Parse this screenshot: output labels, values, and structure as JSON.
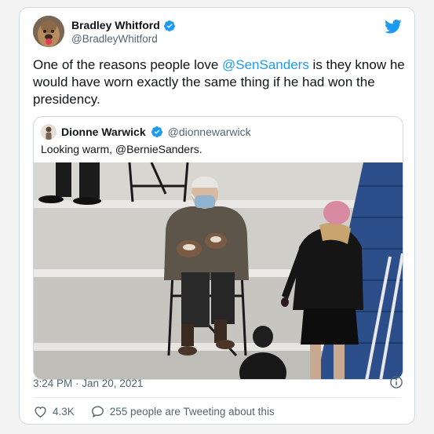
{
  "tweet": {
    "author_name": "Bradley Whitford",
    "author_handle": "@BradleyWhitford",
    "text_before": "One of the reasons people love ",
    "mention": "@SenSanders",
    "text_after": " is they know he would have worn exactly the same thing if he had won the presidency.",
    "timestamp": "3:24 PM · Jan 20, 2021",
    "likes": "4.3K",
    "tweeting_about": "255 people are Tweeting about this"
  },
  "quoted": {
    "author_name": "Dionne Warwick",
    "author_handle": "@dionnewarwick",
    "text": "Looking warm, @BernieSanders."
  },
  "icons": {
    "verified": "verified-badge-icon",
    "brand": "twitter-bird-icon",
    "info": "info-icon",
    "like": "heart-icon",
    "reply": "speech-bubble-icon"
  },
  "colors": {
    "accent": "#1d9bf0",
    "text": "#0f1419",
    "muted": "#536471",
    "border": "#cfd9de"
  }
}
